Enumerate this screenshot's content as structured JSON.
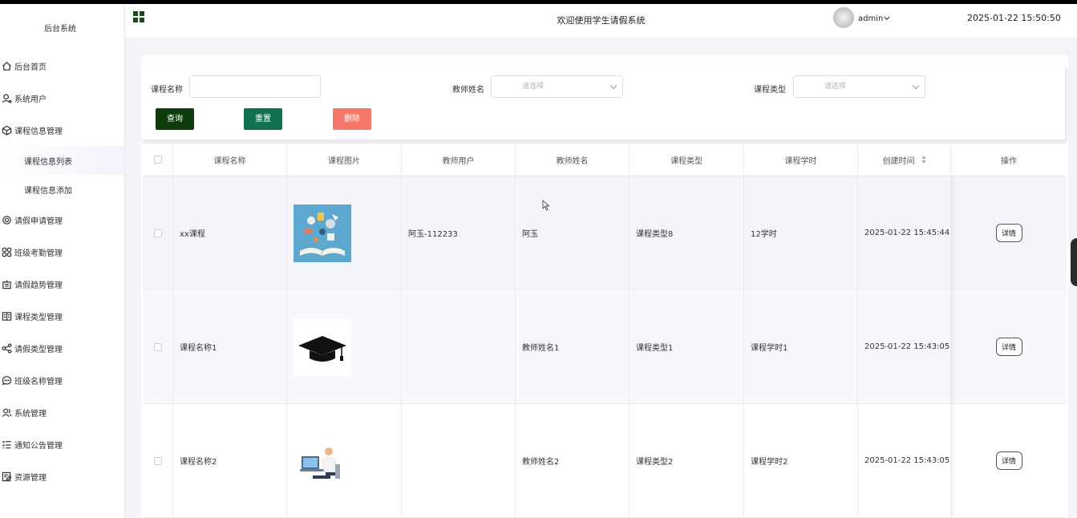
{
  "sidebar": {
    "brand": "后台系统",
    "items": [
      {
        "label": "后台首页",
        "icon": "home-icon"
      },
      {
        "label": "系统用户",
        "icon": "user-icon"
      },
      {
        "label": "课程信息管理",
        "icon": "cube-icon"
      }
    ],
    "subitems": [
      {
        "label": "课程信息列表",
        "active": true
      },
      {
        "label": "课程信息添加",
        "active": false
      }
    ],
    "items_after": [
      {
        "label": "请假申请管理",
        "icon": "gear-icon"
      },
      {
        "label": "班级考勤管理",
        "icon": "grid-icon"
      },
      {
        "label": "请假趋势管理",
        "icon": "tray-icon"
      },
      {
        "label": "课程类型管理",
        "icon": "book-icon"
      },
      {
        "label": "请假类型管理",
        "icon": "share-icon"
      },
      {
        "label": "班级名称管理",
        "icon": "chat-icon"
      },
      {
        "label": "系统管理",
        "icon": "people-icon"
      },
      {
        "label": "通知公告管理",
        "icon": "list-icon"
      },
      {
        "label": "资源管理",
        "icon": "edit-icon"
      }
    ]
  },
  "header": {
    "title": "欢迎使用学生请假系统",
    "user": "admin",
    "datetime": "2025-01-22 15:50:50"
  },
  "search": {
    "course_name_label": "课程名称",
    "course_name_value": "",
    "teacher_name_label": "教师姓名",
    "teacher_name_placeholder": "请选择",
    "course_type_label": "课程类型",
    "course_type_placeholder": "请选择",
    "query_label": "查询",
    "reset_label": "重置",
    "delete_label": "删除"
  },
  "table": {
    "columns": [
      "课程名称",
      "课程图片",
      "教师用户",
      "教师姓名",
      "课程类型",
      "课程学时",
      "创建时间",
      "操作"
    ],
    "rows": [
      {
        "name": "xx课程",
        "teacher_user": "阿玉-112233",
        "teacher_name": "阿玉",
        "type": "课程类型8",
        "hours": "12学时",
        "created": "2025-01-22 15:45:44",
        "action": "详情"
      },
      {
        "name": "课程名称1",
        "teacher_user": "",
        "teacher_name": "教师姓名1",
        "type": "课程类型1",
        "hours": "课程学时1",
        "created": "2025-01-22 15:43:05",
        "action": "详情"
      },
      {
        "name": "课程名称2",
        "teacher_user": "",
        "teacher_name": "教师姓名2",
        "type": "课程类型2",
        "hours": "课程学时2",
        "created": "2025-01-22 15:43:05",
        "action": "详情"
      }
    ]
  },
  "colors": {
    "query": "#0d3d0d",
    "reset": "#0f7052",
    "delete": "#f5786a",
    "main_bg": "#f2f4f9"
  }
}
